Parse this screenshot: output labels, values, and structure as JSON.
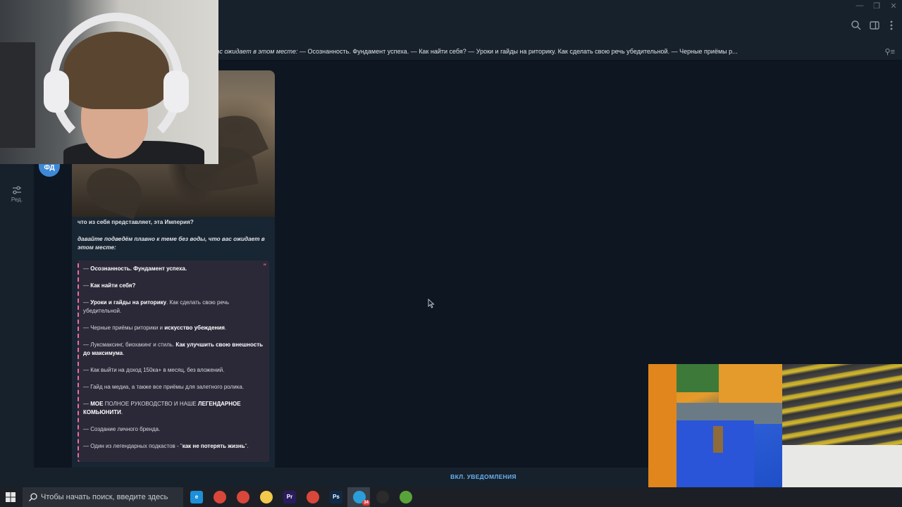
{
  "window": {
    "minimize": "—",
    "restore": "❐",
    "close": "✕"
  },
  "left": {
    "edit_label": "Ред."
  },
  "pinned": {
    "italic_text": "давайте подведём плавно к теме без воды, что вас ожидает в этом месте:",
    "rest_text": "  — Осознанность. Фундамент успеха.  — Как найти себя?  — Уроки и гайды на риторику. Как сделать свою речь убедительной.  — Черные приёмы р..."
  },
  "avatar": {
    "initials": "ФД",
    "color": "#3e88d6"
  },
  "message": {
    "question": "что из себя представляет, эта Империя?",
    "intro": "давайте подведём плавно к теме без воды, что вас ожидает в этом месте:",
    "quote_mark": "”",
    "items": [
      {
        "pre": "— ",
        "bold": "Осознанность. Фундамент успеха.",
        "post": ""
      },
      {
        "pre": "— ",
        "bold": "Как найти себя?",
        "post": ""
      },
      {
        "pre": "— ",
        "bold": "Уроки и гайды на риторику",
        "post": ". Как сделать свою речь убедительной."
      },
      {
        "pre": "— Черные приёмы риторики и ",
        "bold": "искусство убеждения",
        "post": "."
      },
      {
        "pre": "— Луксмаксинг, биохакинг и стиль. ",
        "bold": "Как улучшить свою внешность до максимума",
        "post": "."
      },
      {
        "pre": "— Как выйти на доход 150ка+ в месяц, без вложений.",
        "bold": "",
        "post": ""
      },
      {
        "pre": "— Гайд на медиа, а также все приёмы для залетного ролика.",
        "bold": "",
        "post": ""
      },
      {
        "pre": "— ",
        "bold": "МОЕ",
        "post": " ПОЛНОЕ РУКОВОДСТВО И НАШЕ ",
        "bold2": "ЛЕГЕНДАРНОЕ КОМЬЮНИТИ",
        "post2": "."
      },
      {
        "pre": "— Создание личного бренда.",
        "bold": "",
        "post": ""
      },
      {
        "pre": "— Один из легендарных подкастов - \"",
        "bold": "как не потерять жизнь",
        "post": "\"."
      }
    ]
  },
  "bottom": {
    "notify_label": "ВКЛ. УВЕДОМЛЕНИЯ"
  },
  "taskbar": {
    "search_placeholder": "Чтобы начать поиск, введите здесь",
    "apps": [
      {
        "name": "edge-icon",
        "label": "e",
        "color": "#1d8fd8"
      },
      {
        "name": "chrome-icon",
        "label": "",
        "color": "#d9473a"
      },
      {
        "name": "chrome-icon-2",
        "label": "",
        "color": "#d9473a"
      },
      {
        "name": "folder-icon",
        "label": "",
        "color": "#f2c94c"
      },
      {
        "name": "premiere-icon",
        "label": "Pr",
        "color": "#2a1b5e"
      },
      {
        "name": "chrome-icon-3",
        "label": "",
        "color": "#d9473a"
      },
      {
        "name": "photoshop-icon",
        "label": "Ps",
        "color": "#0f2a48"
      },
      {
        "name": "telegram-icon",
        "label": "",
        "color": "#2a9ed8",
        "badge": "34"
      },
      {
        "name": "obs-icon",
        "label": "",
        "color": "#2b2b2b"
      },
      {
        "name": "minecraft-icon",
        "label": "",
        "color": "#5aa33a"
      }
    ]
  }
}
